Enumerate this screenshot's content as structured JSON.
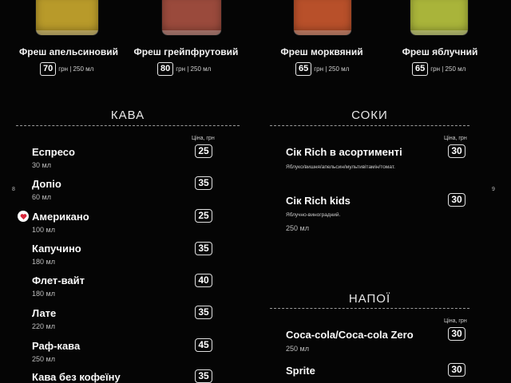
{
  "juices": [
    {
      "name": "Фреш апельсиновий",
      "price": "70",
      "unit": "грн | 250 мл",
      "color": "#b89a2a"
    },
    {
      "name": "Фреш грейпфрутовий",
      "price": "80",
      "unit": "грн | 250 мл",
      "color": "#9a4a3c"
    },
    {
      "name": "Фреш морквяний",
      "price": "65",
      "unit": "грн | 250 мл",
      "color": "#b8502a"
    },
    {
      "name": "Фреш яблучний",
      "price": "65",
      "unit": "грн | 250 мл",
      "color": "#a9b43a"
    }
  ],
  "coffee": {
    "title": "КАВА",
    "price_header": "Ціна, грн",
    "items": [
      {
        "name": "Еспресо",
        "sub": "30 мл",
        "price": "25"
      },
      {
        "name": "Допіо",
        "sub": "60 мл",
        "price": "35"
      },
      {
        "name": "Американо",
        "sub": "100 мл",
        "price": "25"
      },
      {
        "name": "Капучино",
        "sub": "180 мл",
        "price": "35"
      },
      {
        "name": "Флет-вайт",
        "sub": "180 мл",
        "price": "40"
      },
      {
        "name": "Лате",
        "sub": "220 мл",
        "price": "35"
      },
      {
        "name": "Раф-кава",
        "sub": "250 мл",
        "price": "45"
      },
      {
        "name": "Кава без кофеїну",
        "sub": "",
        "price": "35"
      }
    ]
  },
  "juice_section": {
    "title": "СОКИ",
    "price_header": "Ціна, грн",
    "items": [
      {
        "name": "Сік Rich в асортименті",
        "desc": "Яблуко/вишня/апельсин/мультивітамін/томат.",
        "sub": "",
        "price": "30"
      },
      {
        "name": "Сік Rich kids",
        "desc": "Яблучно-виноградний.",
        "sub": "250 мл",
        "price": "30"
      }
    ]
  },
  "drinks": {
    "title": "НАПОЇ",
    "price_header": "Ціна, грн",
    "items": [
      {
        "name": "Coca-cola/Coca-cola Zero",
        "sub": "250 мл",
        "price": "30"
      },
      {
        "name": "Sprite",
        "sub": "",
        "price": "30"
      }
    ]
  },
  "page_left": "8",
  "page_right": "9",
  "accent": "#d8283c"
}
